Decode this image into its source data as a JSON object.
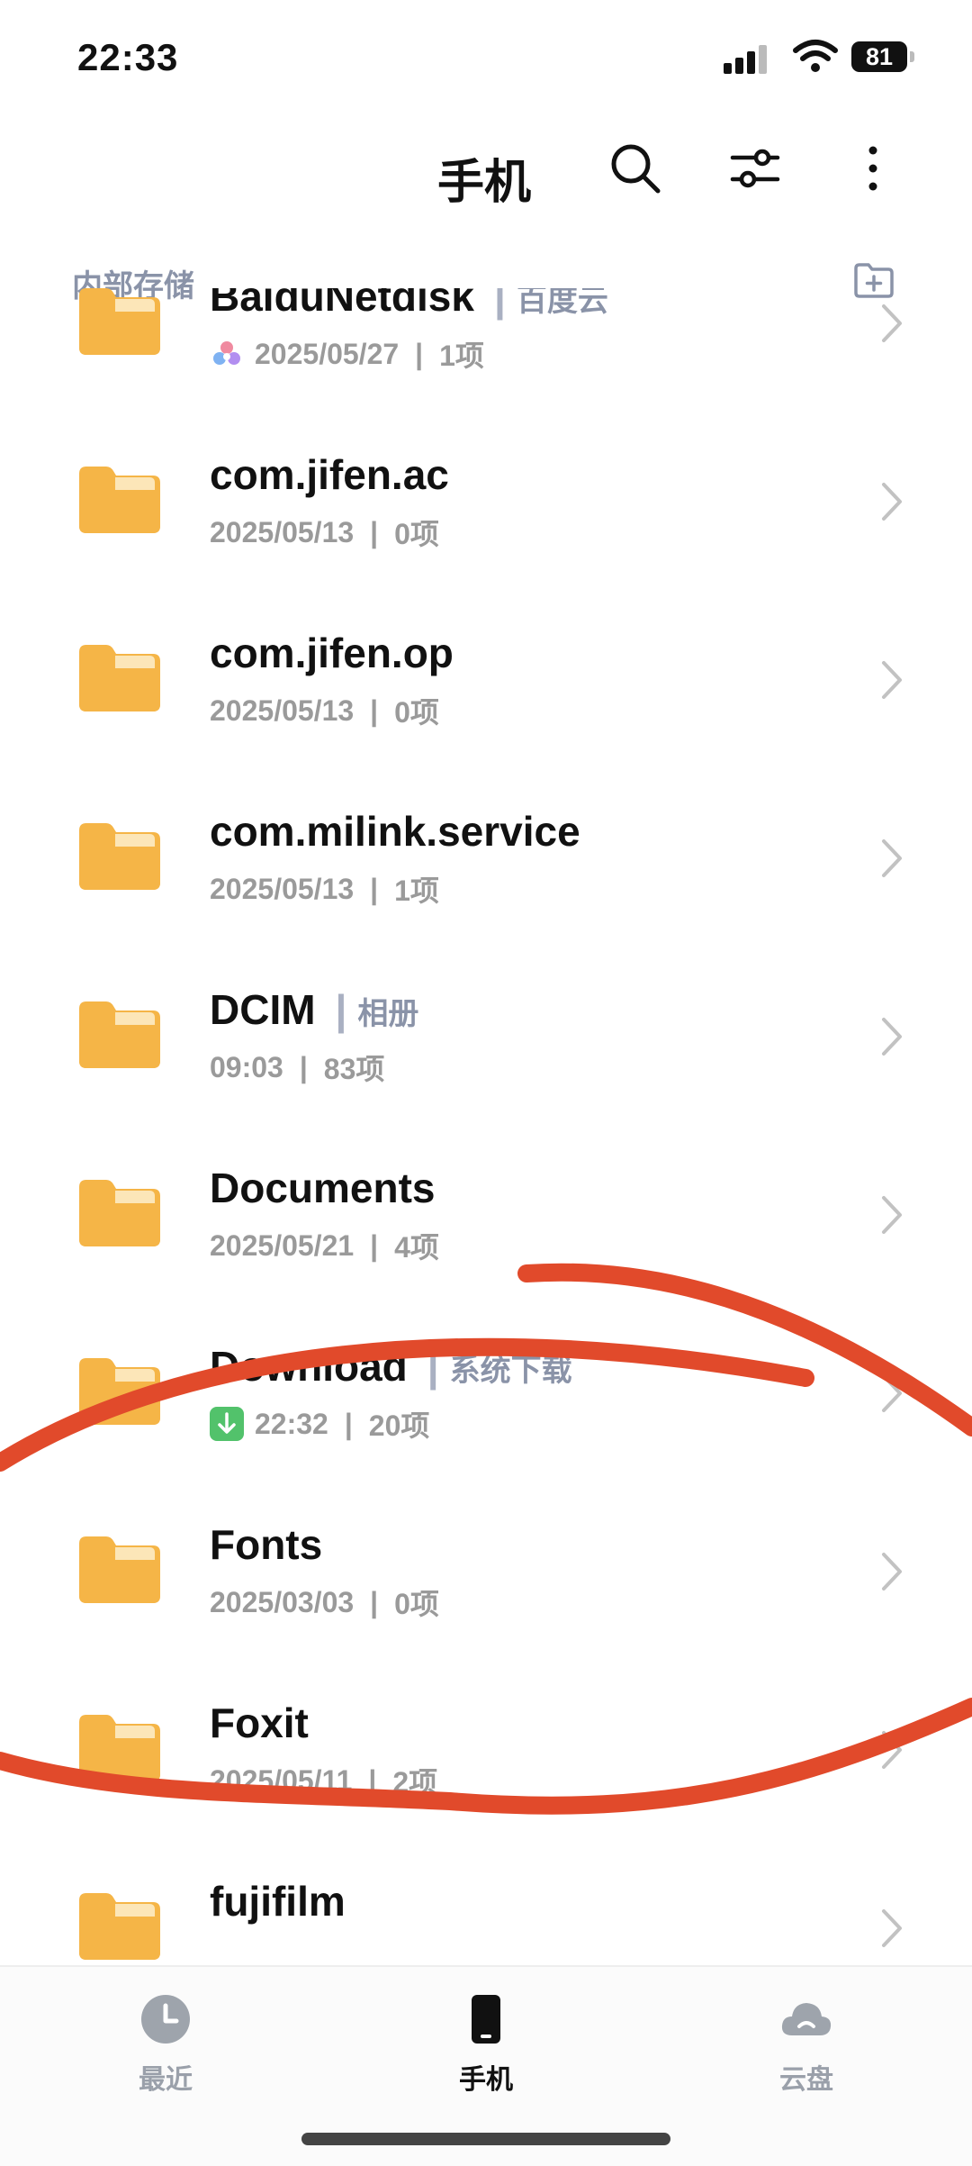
{
  "status_bar": {
    "time": "22:33",
    "battery": "81"
  },
  "header": {
    "title": "手机"
  },
  "section": {
    "label": "内部存储"
  },
  "folders": [
    {
      "name": "BaiduNetdisk",
      "tag": "百度云",
      "date": "2025/05/27",
      "count": "1项",
      "badge": "baidu"
    },
    {
      "name": "com.jifen.ac",
      "tag": "",
      "date": "2025/05/13",
      "count": "0项",
      "badge": ""
    },
    {
      "name": "com.jifen.op",
      "tag": "",
      "date": "2025/05/13",
      "count": "0项",
      "badge": ""
    },
    {
      "name": "com.milink.service",
      "tag": "",
      "date": "2025/05/13",
      "count": "1项",
      "badge": ""
    },
    {
      "name": "DCIM",
      "tag": "相册",
      "date": "09:03",
      "count": "83项",
      "badge": ""
    },
    {
      "name": "Documents",
      "tag": "",
      "date": "2025/05/21",
      "count": "4项",
      "badge": ""
    },
    {
      "name": "Download",
      "tag": "系统下载",
      "date": "22:32",
      "count": "20项",
      "badge": "download"
    },
    {
      "name": "Fonts",
      "tag": "",
      "date": "2025/03/03",
      "count": "0项",
      "badge": ""
    },
    {
      "name": "Foxit",
      "tag": "",
      "date": "2025/05/11",
      "count": "2项",
      "badge": ""
    },
    {
      "name": "fujifilm",
      "tag": "",
      "date": "",
      "count": "",
      "badge": ""
    }
  ],
  "tabs": [
    {
      "label": "最近",
      "icon": "clock-icon",
      "active": false
    },
    {
      "label": "手机",
      "icon": "phone-icon",
      "active": true
    },
    {
      "label": "云盘",
      "icon": "cloud-icon",
      "active": false
    }
  ],
  "colors": {
    "folder": "#F5B547",
    "scribble": "#E14A2B",
    "accent": "#8A93A8"
  }
}
